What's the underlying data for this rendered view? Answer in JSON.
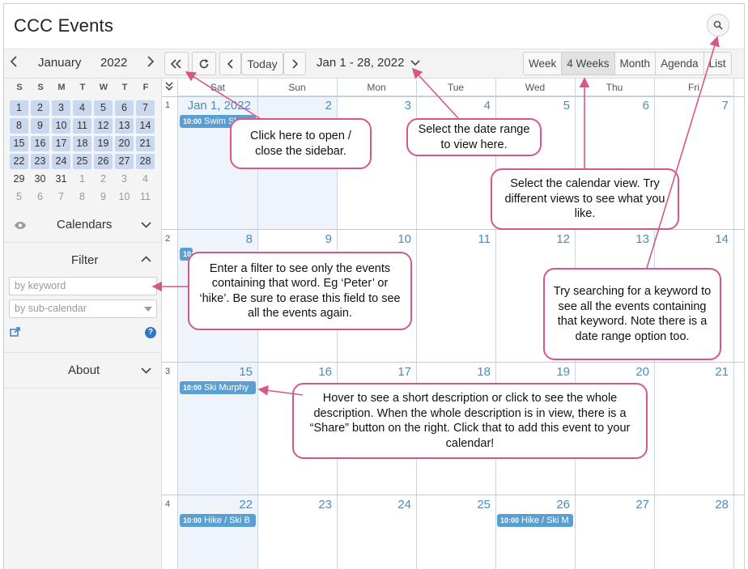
{
  "app": {
    "title": "CCC Events"
  },
  "toolbar": {
    "mini_month": "January",
    "mini_year": "2022",
    "today_label": "Today",
    "date_range": "Jan 1 - 28, 2022",
    "views": [
      "Week",
      "4 Weeks",
      "Month",
      "Agenda",
      "List"
    ],
    "active_view": "4 Weeks"
  },
  "mini_calendar": {
    "headers": [
      "S",
      "S",
      "M",
      "T",
      "W",
      "T",
      "F"
    ],
    "rows": [
      [
        "1",
        "2",
        "3",
        "4",
        "5",
        "6",
        "7"
      ],
      [
        "8",
        "9",
        "10",
        "11",
        "12",
        "13",
        "14"
      ],
      [
        "15",
        "16",
        "17",
        "18",
        "19",
        "20",
        "21"
      ],
      [
        "22",
        "23",
        "24",
        "25",
        "26",
        "27",
        "28"
      ],
      [
        "29",
        "30",
        "31",
        "1",
        "2",
        "3",
        "4"
      ],
      [
        "5",
        "6",
        "7",
        "8",
        "9",
        "10",
        "11"
      ]
    ]
  },
  "sidebar": {
    "calendars_label": "Calendars",
    "filter_label": "Filter",
    "keyword_placeholder": "by keyword",
    "subcal_placeholder": "by sub-calendar",
    "about_label": "About"
  },
  "calendar": {
    "day_headers": [
      "Sat",
      "Sun",
      "Mon",
      "Tue",
      "Wed",
      "Thu",
      "Fri"
    ],
    "weeks": [
      {
        "num": "1",
        "days": [
          "Jan 1, 2022",
          "2",
          "3",
          "4",
          "5",
          "6",
          "7"
        ]
      },
      {
        "num": "2",
        "days": [
          "8",
          "9",
          "10",
          "11",
          "12",
          "13",
          "14"
        ]
      },
      {
        "num": "3",
        "days": [
          "15",
          "16",
          "17",
          "18",
          "19",
          "20",
          "21"
        ]
      },
      {
        "num": "4",
        "days": [
          "22",
          "23",
          "24",
          "25",
          "26",
          "27",
          "28"
        ]
      }
    ],
    "events": [
      {
        "time": "10:00",
        "title": "Swim Sk"
      },
      {
        "time": "10:00",
        "title": ""
      },
      {
        "time": "10:00",
        "title": "Ski Murphy"
      },
      {
        "time": "10:00",
        "title": "Hike / Ski B"
      },
      {
        "time": "10:00",
        "title": "Hike / Ski M"
      }
    ]
  },
  "callouts": {
    "sidebar": "Click here to open / close the sidebar.",
    "range": "Select the date range to view here.",
    "view": "Select the calendar view. Try different views to see what you like.",
    "filter": "Enter a filter to see only the events containing that word. Eg ‘Peter’ or ‘hike’. Be sure to erase this field to see all the events again.",
    "search": "Try searching for a keyword to see all the events containing that keyword. Note there is a date range option too.",
    "event": "Hover to see a short description or click to see the whole description. When the whole description is in view, there is a “Share” button on the right. Click that to add this event to your calendar!"
  },
  "colors": {
    "accent": "#d6588a",
    "event": "#5a9fd1",
    "daynum": "#4a8bc5",
    "range": "#c9d8ee"
  }
}
